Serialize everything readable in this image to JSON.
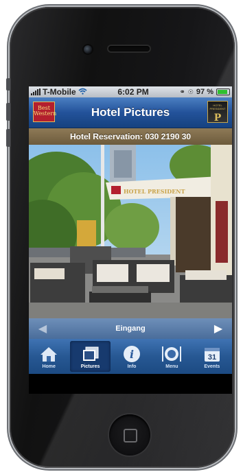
{
  "status_bar": {
    "carrier": "T-Mobile",
    "time": "6:02 PM",
    "battery": "97 %"
  },
  "nav_bar": {
    "title": "Hotel Pictures",
    "brand_logo_text": "Best Western",
    "hotel_logo_text": "HOTEL PRESIDENT"
  },
  "reservation": {
    "label": "Hotel Reservation: 030 2190 30"
  },
  "photo": {
    "sign_text": "HOTEL PRESIDENT",
    "caption": "Eingang"
  },
  "tabs": [
    {
      "label": "Home",
      "icon": "home-icon",
      "active": false
    },
    {
      "label": "Pictures",
      "icon": "pictures-icon",
      "active": true
    },
    {
      "label": "Info",
      "icon": "info-icon",
      "active": false
    },
    {
      "label": "Menu",
      "icon": "menu-icon",
      "active": false
    },
    {
      "label": "Events",
      "icon": "calendar-icon",
      "active": false,
      "badge": "31"
    }
  ],
  "colors": {
    "navbar": "#23529a",
    "reservation_bar": "#7a6647",
    "tabbar": "#275893"
  }
}
